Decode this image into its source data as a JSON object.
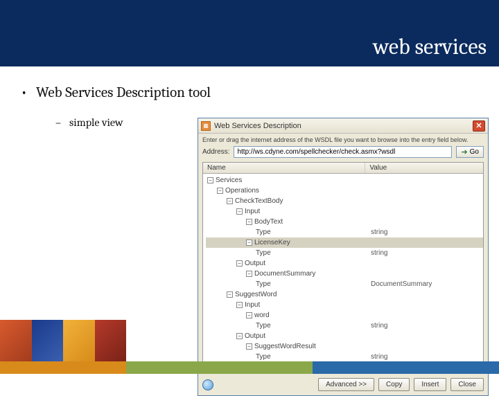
{
  "slide": {
    "title": "web services",
    "bullet1": "Web Services Description tool",
    "bullet2": "simple view"
  },
  "window": {
    "title": "Web Services Description",
    "hint": "Enter or drag the internet address of the WSDL file you want to browse into the entry field below.",
    "addressLabel": "Address:",
    "addressValue": "http://ws.cdyne.com/spellchecker/check.asmx?wsdl",
    "goLabel": "Go",
    "columns": {
      "name": "Name",
      "value": "Value"
    },
    "tree": {
      "services": "Services",
      "operations": "Operations",
      "op1": "CheckTextBody",
      "input": "Input",
      "bodyText": "BodyText",
      "type": "Type",
      "licenseKey": "LicenseKey",
      "output": "Output",
      "docSummary": "DocumentSummary",
      "op2": "SuggestWord",
      "word": "word",
      "suggestResult": "SuggestWordResult",
      "valString": "string",
      "valDocSummary": "DocumentSummary"
    },
    "buttons": {
      "advanced": "Advanced >>",
      "copy": "Copy",
      "insert": "Insert",
      "close": "Close"
    }
  }
}
